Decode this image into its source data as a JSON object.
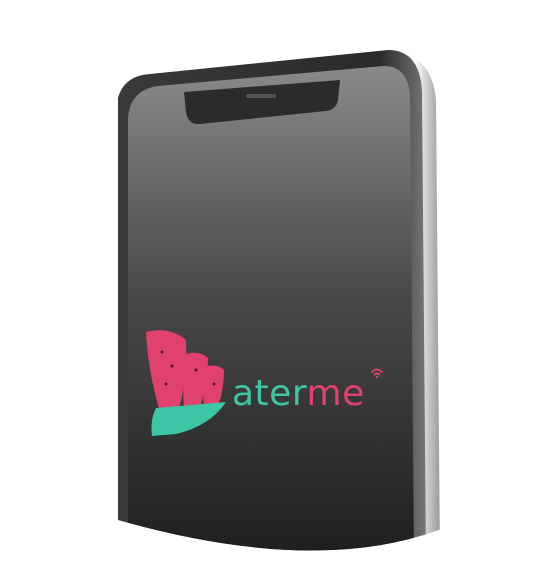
{
  "brand": {
    "logo_text": "aterme",
    "logo_text_part1": "ater",
    "logo_text_part2": "me",
    "colors": {
      "teal": "#3dc6a6",
      "pink": "#e0416d"
    },
    "logo_icon": "leaf-w-icon",
    "signal_icon": "wifi-icon"
  },
  "device": {
    "type": "smartphone",
    "screen_color": "#2a2a2a"
  }
}
